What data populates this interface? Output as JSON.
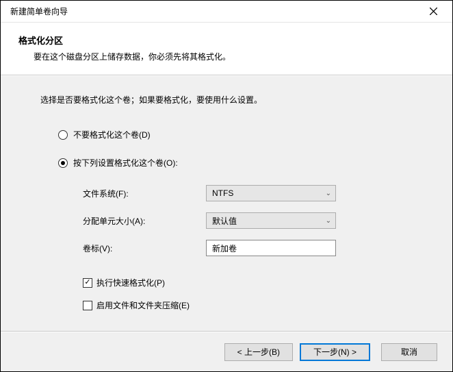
{
  "window": {
    "title": "新建简单卷向导"
  },
  "header": {
    "title": "格式化分区",
    "subtitle": "要在这个磁盘分区上储存数据，你必须先将其格式化。"
  },
  "body": {
    "instruction": "选择是否要格式化这个卷；如果要格式化，要使用什么设置。",
    "radio_no_format": "不要格式化这个卷(D)",
    "radio_format": "按下列设置格式化这个卷(O):",
    "filesystem_label": "文件系统(F):",
    "filesystem_value": "NTFS",
    "alloc_label": "分配单元大小(A):",
    "alloc_value": "默认值",
    "volume_label": "卷标(V):",
    "volume_value": "新加卷",
    "quick_format": "执行快速格式化(P)",
    "compress": "启用文件和文件夹压缩(E)"
  },
  "footer": {
    "back": "< 上一步(B)",
    "next": "下一步(N) >",
    "cancel": "取消"
  }
}
